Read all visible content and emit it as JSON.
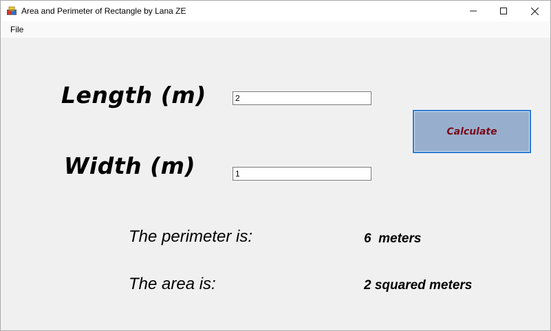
{
  "window": {
    "title": "Area and Perimeter of Rectangle by Lana ZE"
  },
  "menu": {
    "file_label": "File"
  },
  "form": {
    "length_label": "Length (m)",
    "length_value": "2",
    "width_label": "Width (m)",
    "width_value": "1",
    "calculate_label": "Calculate"
  },
  "results": {
    "perimeter_label": "The perimeter is:",
    "perimeter_value": "6  meters",
    "area_label": "The area is:",
    "area_value": "2 squared meters"
  },
  "colors": {
    "button_bg": "#97afcd",
    "button_border": "#2b7cd3",
    "button_text": "#7a0a1a"
  }
}
